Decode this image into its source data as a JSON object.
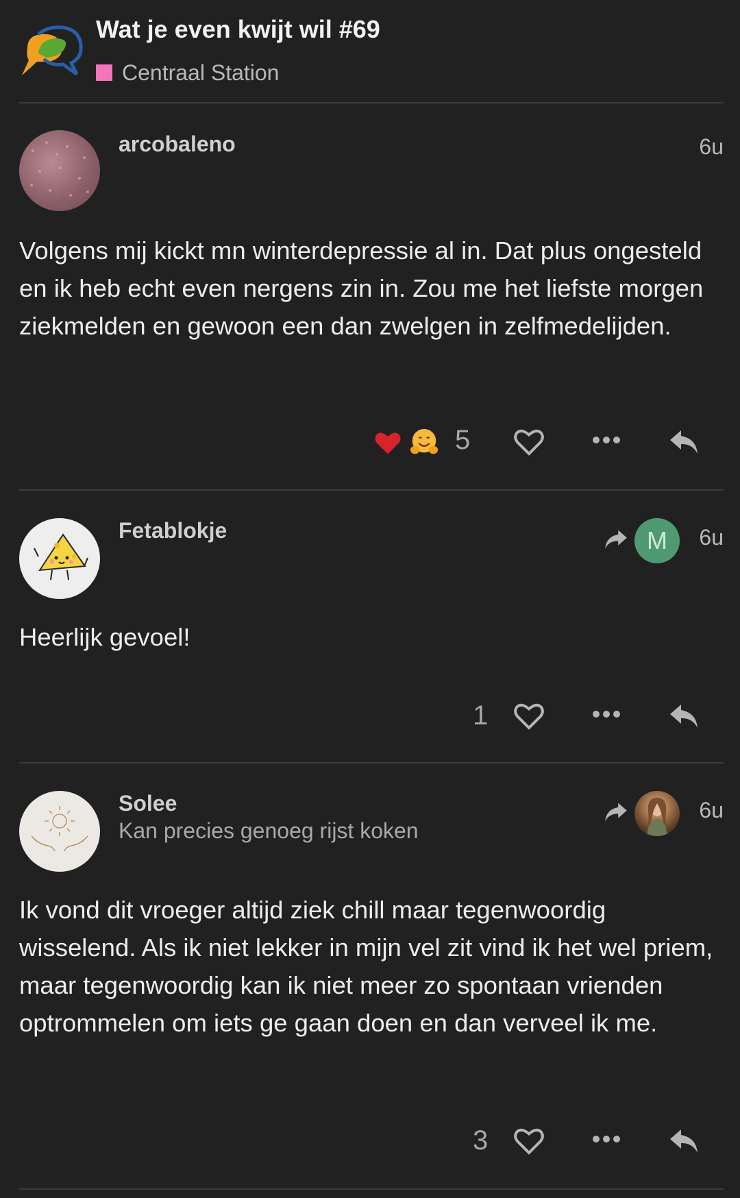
{
  "topic": {
    "title": "Wat je even kwijt wil #69",
    "category": "Centraal Station",
    "category_color": "#f274bd"
  },
  "posts": [
    {
      "username": "arcobaleno",
      "date": "6u",
      "body": "Volgens mij kickt mn winterdepressie al in. Dat plus ongesteld en ik heb echt even nergens zin in. Zou me het liefste morgen ziekmelden en gewoon een dan zwelgen in zelfmedelijden.",
      "reactions": [
        "heart-emoji",
        "hugging-face-emoji"
      ],
      "like_count": "5"
    },
    {
      "username": "Fetablokje",
      "date": "6u",
      "reply_to_initial": "M",
      "body": "Heerlijk gevoel!",
      "like_count": "1"
    },
    {
      "username": "Solee",
      "user_title": "Kan precies genoeg rijst koken",
      "date": "6u",
      "body": "Ik vond dit vroeger altijd ziek chill maar tegenwoordig wisselend. Als ik niet lekker in mijn vel zit vind ik het wel priem, maar tegenwoordig kan ik niet meer zo spontaan vrienden optrommelen om iets ge gaan doen en dan verveel ik me.",
      "like_count": "3"
    }
  ]
}
